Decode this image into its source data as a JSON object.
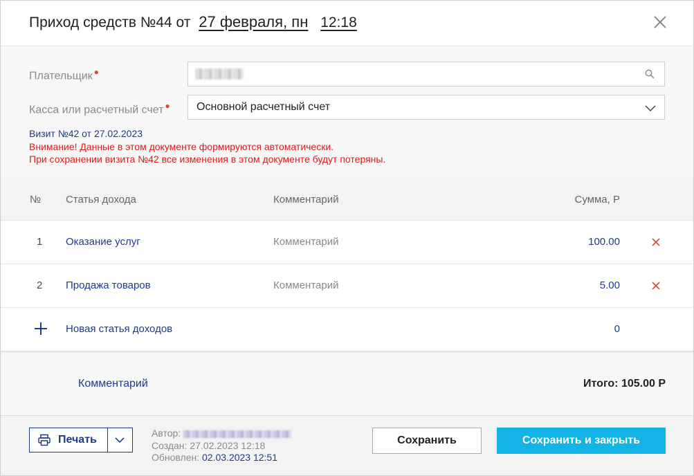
{
  "header": {
    "title": "Приход средств №44 от",
    "date": "27 февраля, пн",
    "time": "12:18"
  },
  "form": {
    "payer_label": "Плательщик",
    "cash_label": "Касса или расчетный счет",
    "cash_value": "Основной расчетный счет",
    "visit_note": "Визит №42 от 27.02.2023",
    "warning_line1": "Внимание! Данные в этом документе формируются автоматически.",
    "warning_line2": "При сохранении визита №42 все изменения в этом документе будут потеряны."
  },
  "table": {
    "headers": {
      "num": "№",
      "article": "Статья дохода",
      "comment": "Комментарий",
      "sum": "Сумма, Р"
    },
    "rows": [
      {
        "num": "1",
        "article": "Оказание услуг",
        "comment": "Комментарий",
        "sum": "100.00"
      },
      {
        "num": "2",
        "article": "Продажа товаров",
        "comment": "Комментарий",
        "sum": "5.00"
      }
    ],
    "new_row": {
      "label": "Новая статья доходов",
      "sum": "0"
    }
  },
  "totals": {
    "comment_link": "Комментарий",
    "total": "Итого: 105.00 Р"
  },
  "footer": {
    "print_label": "Печать",
    "author_label": "Автор:",
    "created": "Создан: 27.02.2023 12:18",
    "updated_label": "Обновлен:",
    "updated_value": "02.03.2023 12:51",
    "save_label": "Сохранить",
    "save_close_label": "Сохранить и закрыть"
  },
  "colors": {
    "accent": "#12b4e6",
    "link": "#1f3a8a",
    "warning": "#e0191b",
    "delete": "#e0453a"
  },
  "icons": [
    "close-icon",
    "search-icon",
    "chevron-down-icon",
    "delete-icon",
    "plus-icon",
    "printer-icon"
  ]
}
